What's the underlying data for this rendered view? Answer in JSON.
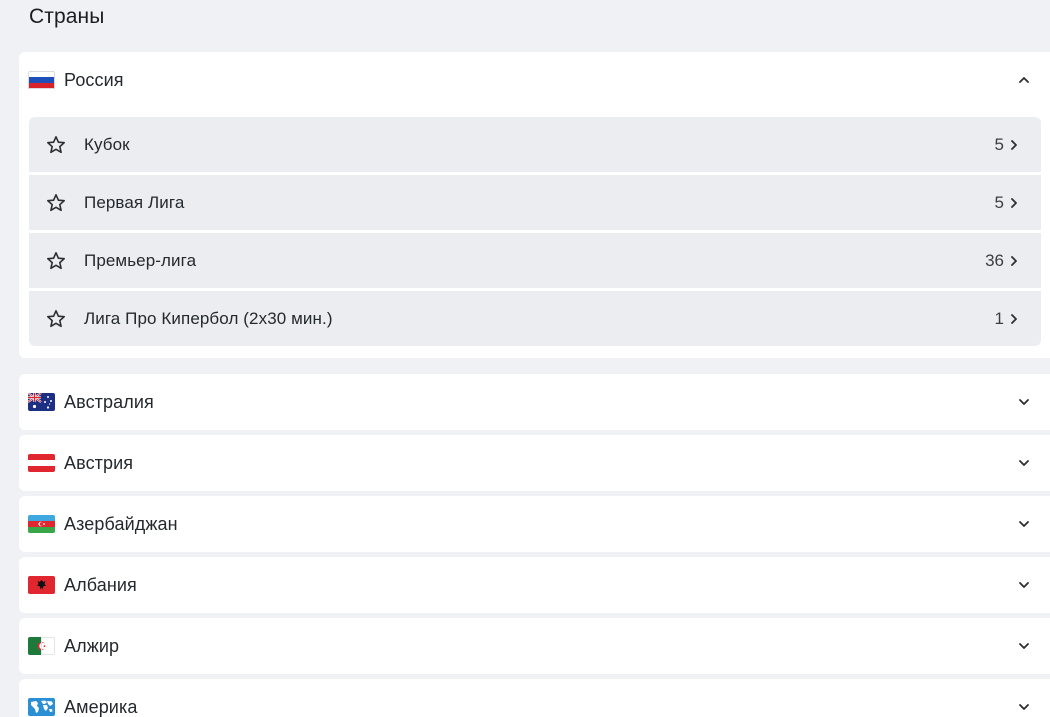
{
  "page": {
    "title": "Страны"
  },
  "countries": [
    {
      "name": "Россия",
      "flag": "russia-flag-icon",
      "expanded": true,
      "leagues": [
        {
          "name": "Кубок",
          "count": "5"
        },
        {
          "name": "Первая Лига",
          "count": "5"
        },
        {
          "name": "Премьер-лига",
          "count": "36"
        },
        {
          "name": "Лига Про Кипербол (2x30 мин.)",
          "count": "1"
        }
      ]
    },
    {
      "name": "Австралия",
      "flag": "australia-flag-icon",
      "expanded": false
    },
    {
      "name": "Австрия",
      "flag": "austria-flag-icon",
      "expanded": false
    },
    {
      "name": "Азербайджан",
      "flag": "azerbaijan-flag-icon",
      "expanded": false
    },
    {
      "name": "Албания",
      "flag": "albania-flag-icon",
      "expanded": false
    },
    {
      "name": "Алжир",
      "flag": "algeria-flag-icon",
      "expanded": false
    },
    {
      "name": "Америка",
      "flag": "world-map-icon",
      "expanded": false
    }
  ],
  "icons": {
    "expand": "chevron-down-icon",
    "collapse": "chevron-up-icon",
    "favorite": "star-outline-icon",
    "open": "chevron-right-icon"
  },
  "colors": {
    "background": "#f0f1f4",
    "card": "#ffffff",
    "league_row": "#ebedf0",
    "text": "#24292e"
  }
}
